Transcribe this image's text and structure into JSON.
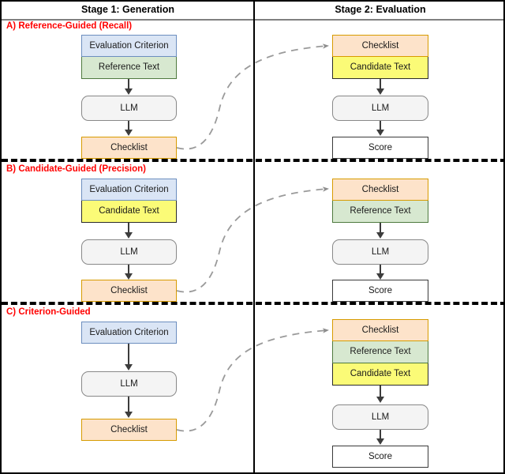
{
  "header": {
    "stage1": "Stage 1: Generation",
    "stage2": "Stage 2: Evaluation"
  },
  "labels": {
    "evaluation_criterion": "Evaluation Criterion",
    "reference_text": "Reference Text",
    "candidate_text": "Candidate Text",
    "llm": "LLM",
    "checklist": "Checklist",
    "score": "Score"
  },
  "sections": [
    {
      "id": "A",
      "title": "A) Reference-Guided (Recall)",
      "generation": {
        "inputs": [
          "Evaluation Criterion",
          "Reference Text"
        ],
        "model": "LLM",
        "output": "Checklist"
      },
      "evaluation": {
        "inputs": [
          "Checklist",
          "Candidate Text"
        ],
        "model": "LLM",
        "output": "Score"
      }
    },
    {
      "id": "B",
      "title": "B) Candidate-Guided (Precision)",
      "generation": {
        "inputs": [
          "Evaluation Criterion",
          "Candidate Text"
        ],
        "model": "LLM",
        "output": "Checklist"
      },
      "evaluation": {
        "inputs": [
          "Checklist",
          "Reference Text"
        ],
        "model": "LLM",
        "output": "Score"
      }
    },
    {
      "id": "C",
      "title": "C) Criterion-Guided",
      "generation": {
        "inputs": [
          "Evaluation Criterion"
        ],
        "model": "LLM",
        "output": "Checklist"
      },
      "evaluation": {
        "inputs": [
          "Checklist",
          "Reference Text",
          "Candidate Text"
        ],
        "model": "LLM",
        "output": "Score"
      }
    }
  ],
  "colors": {
    "criterion_fill": "#dae5f5",
    "criterion_stroke": "#6c8ebf",
    "reference_fill": "#d7e8d0",
    "reference_stroke": "#4f7a3f",
    "candidate_fill": "#fbfb77",
    "candidate_stroke": "#2b2b2b",
    "checklist_fill": "#fde3ca",
    "checklist_stroke": "#d79b00",
    "llm_fill": "#f4f4f4",
    "llm_stroke": "#888888",
    "score_fill": "#ffffff",
    "score_stroke": "#3a3a3a",
    "section_label": "#ff0000",
    "connector": "#9a9a9a"
  }
}
